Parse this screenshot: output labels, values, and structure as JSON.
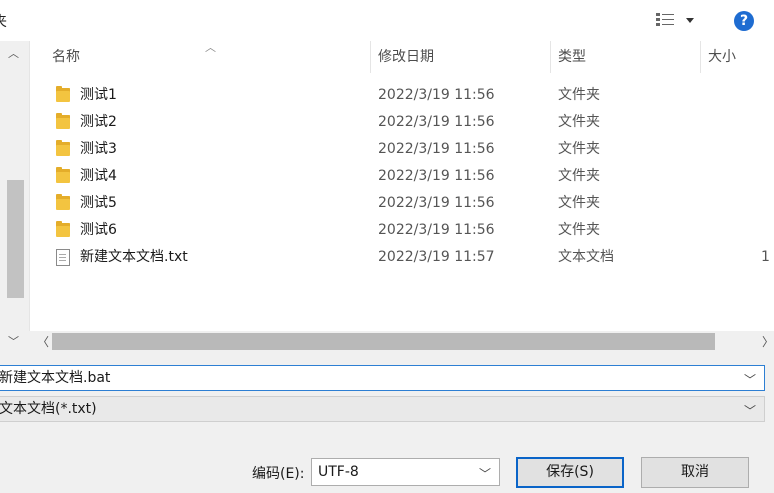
{
  "top": {
    "left_label": "夹"
  },
  "columns": {
    "name": "名称",
    "date": "修改日期",
    "type": "类型",
    "size": "大小"
  },
  "files": [
    {
      "name": "测试1",
      "date": "2022/3/19 11:56",
      "type": "文件夹",
      "size": "",
      "icon": "folder-icon"
    },
    {
      "name": "测试2",
      "date": "2022/3/19 11:56",
      "type": "文件夹",
      "size": "",
      "icon": "folder-icon"
    },
    {
      "name": "测试3",
      "date": "2022/3/19 11:56",
      "type": "文件夹",
      "size": "",
      "icon": "folder-icon"
    },
    {
      "name": "测试4",
      "date": "2022/3/19 11:56",
      "type": "文件夹",
      "size": "",
      "icon": "folder-icon"
    },
    {
      "name": "测试5",
      "date": "2022/3/19 11:56",
      "type": "文件夹",
      "size": "",
      "icon": "folder-icon"
    },
    {
      "name": "测试6",
      "date": "2022/3/19 11:56",
      "type": "文件夹",
      "size": "",
      "icon": "folder-icon"
    },
    {
      "name": "新建文本文档.txt",
      "date": "2022/3/19 11:57",
      "type": "文本文档",
      "size": "1",
      "icon": "text-file-icon"
    }
  ],
  "filename": {
    "value": "新建文本文档.bat"
  },
  "filetype": {
    "value": "文本文档(*.txt)"
  },
  "encoding": {
    "label": "编码(E):",
    "value": "UTF-8"
  },
  "buttons": {
    "save": "保存(S)",
    "cancel": "取消"
  },
  "help": {
    "glyph": "?"
  },
  "colors": {
    "accent": "#0a64c8",
    "help": "#1e6cd1",
    "folder": "#f3c440"
  }
}
